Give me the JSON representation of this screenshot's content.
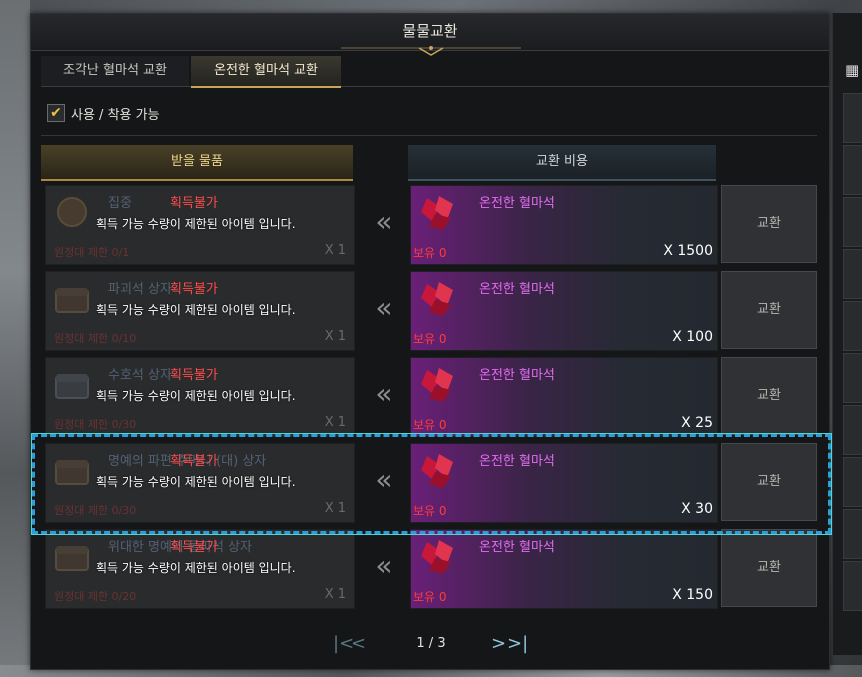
{
  "window": {
    "title": "물물교환"
  },
  "tabs": [
    {
      "label": "조각난 혈마석 교환",
      "active": false
    },
    {
      "label": "온전한 혈마석 교환",
      "active": true
    }
  ],
  "filter": {
    "label": "사용 / 착용 가능",
    "checked": true
  },
  "headers": {
    "reward": "받을 물품",
    "cost": "교환 비용"
  },
  "rows": [
    {
      "faded_name": "집중",
      "faded_limit": "원정대 제한 0/1",
      "faded_qty": "X 1",
      "unavailable": "획득불가",
      "message": "획득 가능 수량이 제한된 아이템 입니다.",
      "cost_item": "온전한 혈마석",
      "owned": "보유 0",
      "cost_qty": "X 1500",
      "button": "교환"
    },
    {
      "faded_name": "파괴석 상자",
      "faded_limit": "원정대 제한 0/10",
      "faded_qty": "X 1",
      "unavailable": "획득불가",
      "message": "획득 가능 수량이 제한된 아이템 입니다.",
      "cost_item": "온전한 혈마석",
      "owned": "보유 0",
      "cost_qty": "X 100",
      "button": "교환"
    },
    {
      "faded_name": "수호석 상자",
      "faded_limit": "원정대 제한 0/30",
      "faded_qty": "X 1",
      "unavailable": "획득불가",
      "message": "획득 가능 수량이 제한된 아이템 입니다.",
      "cost_item": "온전한 혈마석",
      "owned": "보유 0",
      "cost_qty": "X 25",
      "button": "교환"
    },
    {
      "faded_name": "명예의 파편 주머니 (대) 상자",
      "faded_limit": "원정대 제한 0/30",
      "faded_qty": "X 1",
      "unavailable": "획득불가",
      "message": "획득 가능 수량이 제한된 아이템 입니다.",
      "cost_item": "온전한 혈마석",
      "owned": "보유 0",
      "cost_qty": "X 30",
      "button": "교환"
    },
    {
      "faded_name": "위대한 명예의 돌파석 상자",
      "faded_limit": "원정대 제한 0/20",
      "faded_qty": "X 1",
      "unavailable": "획득불가",
      "message": "획득 가능 수량이 제한된 아이템 입니다.",
      "cost_item": "온전한 혈마석",
      "owned": "보유 0",
      "cost_qty": "X 150",
      "button": "교환"
    }
  ],
  "pager": {
    "text": "1 / 3",
    "first_icon": "first-page-icon",
    "prev_icon": "prev-page-icon",
    "next_icon": "next-page-icon",
    "last_icon": "last-page-icon"
  },
  "colors": {
    "unavailable_text": "#ff4b4b",
    "cost_item_text": "#e36cf0",
    "highlight_border": "#2e9ed8",
    "active_tab_accent": "#c8a55a"
  }
}
